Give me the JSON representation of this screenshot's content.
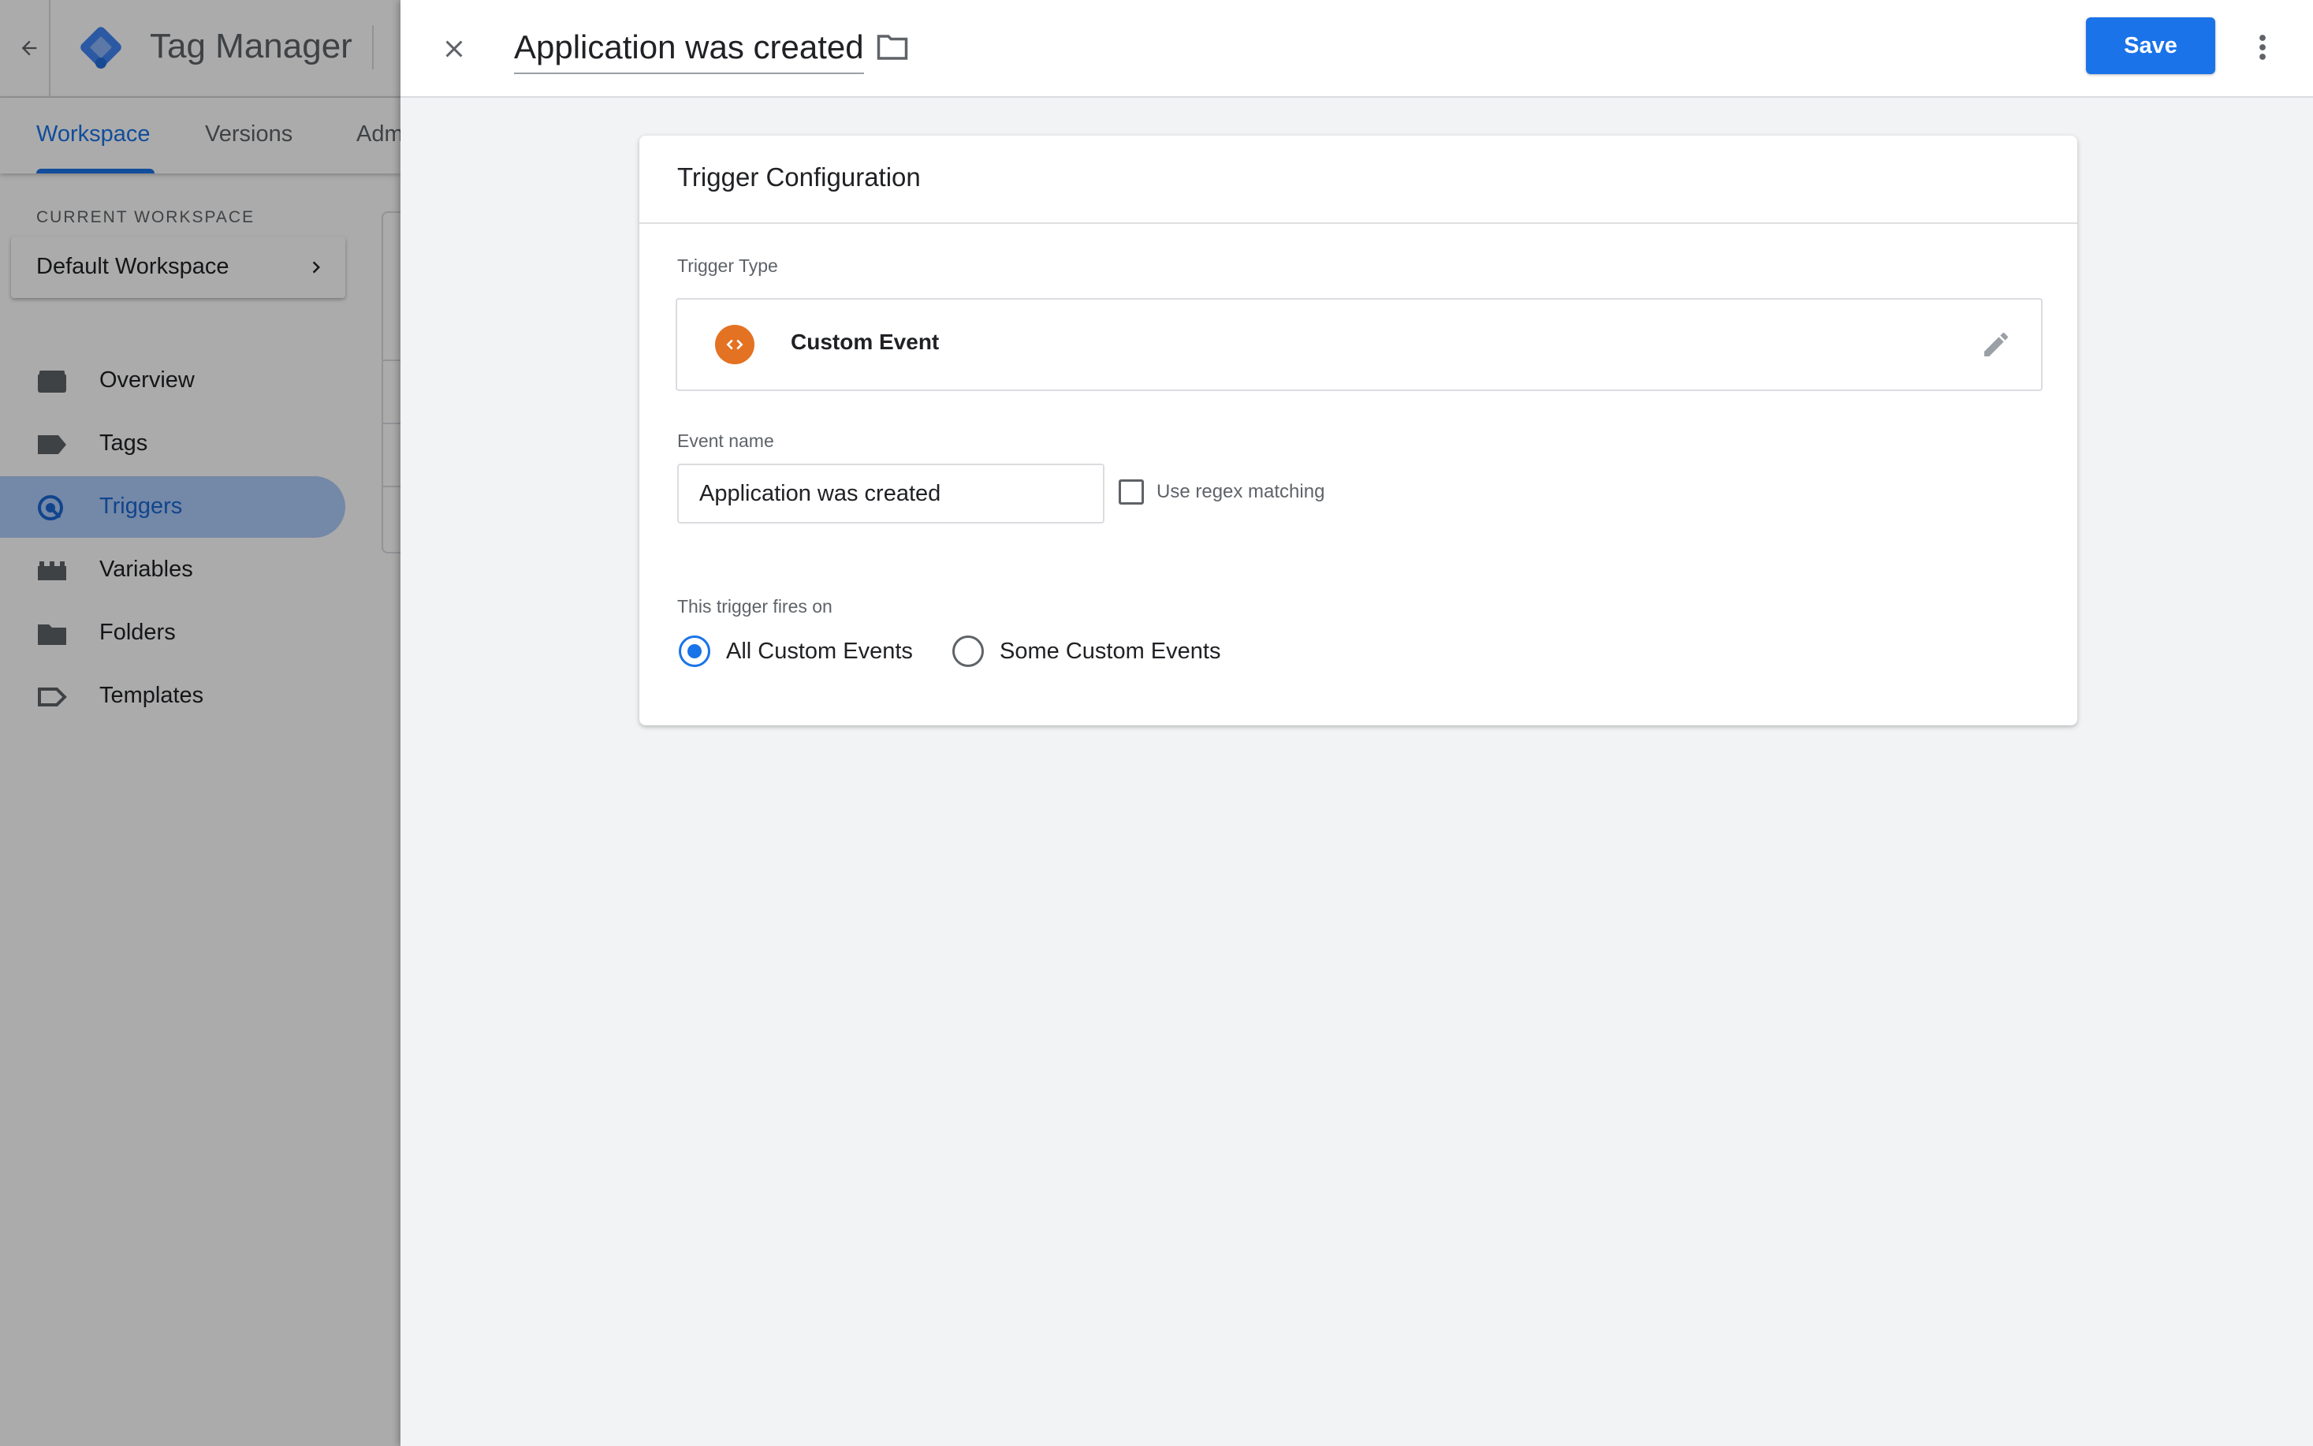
{
  "background_app": {
    "title": "Tag Manager",
    "tabs": [
      {
        "label": "Workspace",
        "active": true
      },
      {
        "label": "Versions",
        "active": false
      },
      {
        "label": "Admin",
        "active": false
      }
    ],
    "workspace_label": "CURRENT WORKSPACE",
    "workspace_name": "Default Workspace",
    "nav_items": [
      {
        "label": "Overview",
        "icon": "briefcase-icon",
        "active": false
      },
      {
        "label": "Tags",
        "icon": "tag-icon",
        "active": false
      },
      {
        "label": "Triggers",
        "icon": "trigger-icon",
        "active": true
      },
      {
        "label": "Variables",
        "icon": "blocks-icon",
        "active": false
      },
      {
        "label": "Folders",
        "icon": "folder-icon",
        "active": false
      },
      {
        "label": "Templates",
        "icon": "template-icon",
        "active": false
      }
    ]
  },
  "panel": {
    "trigger_name": "Application was created",
    "save_label": "Save",
    "card": {
      "title": "Trigger Configuration",
      "trigger_type_label": "Trigger Type",
      "trigger_type_name": "Custom Event",
      "event_name_label": "Event name",
      "event_name_value": "Application was created",
      "regex_label": "Use regex matching",
      "regex_checked": false,
      "fires_on_label": "This trigger fires on",
      "fires_on_options": [
        {
          "label": "All Custom Events",
          "selected": true
        },
        {
          "label": "Some Custom Events",
          "selected": false
        }
      ]
    }
  },
  "colors": {
    "accent": "#1a73e8",
    "custom_event_icon": "#e37222",
    "active_nav_bg": "#aecbfa"
  }
}
